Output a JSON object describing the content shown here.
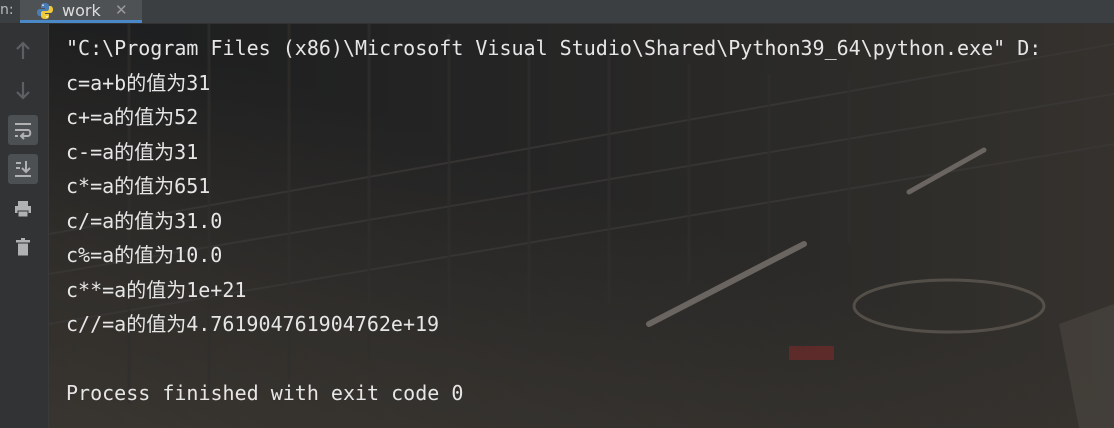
{
  "tabbar": {
    "prefix": "n:",
    "tab_label": "work",
    "tab_close": "✕",
    "tab_icon": "python-icon"
  },
  "toolbar": {
    "buttons": [
      {
        "name": "up-arrow-icon"
      },
      {
        "name": "down-arrow-icon"
      },
      {
        "name": "soft-wrap-icon"
      },
      {
        "name": "scroll-to-end-icon"
      },
      {
        "name": "print-icon"
      },
      {
        "name": "trash-icon"
      }
    ]
  },
  "console": {
    "lines": [
      "\"C:\\Program Files (x86)\\Microsoft Visual Studio\\Shared\\Python39_64\\python.exe\" D:",
      "c=a+b的值为31",
      "c+=a的值为52",
      "c-=a的值为31",
      "c*=a的值为651",
      "c/=a的值为31.0",
      "c%=a的值为10.0",
      "c**=a的值为1e+21",
      "c//=a的值为4.761904761904762e+19",
      "",
      "Process finished with exit code 0"
    ]
  },
  "colors": {
    "text": "#e6e6e6",
    "tab_underline": "#4a88c7",
    "gutter_bg": "#313335"
  }
}
